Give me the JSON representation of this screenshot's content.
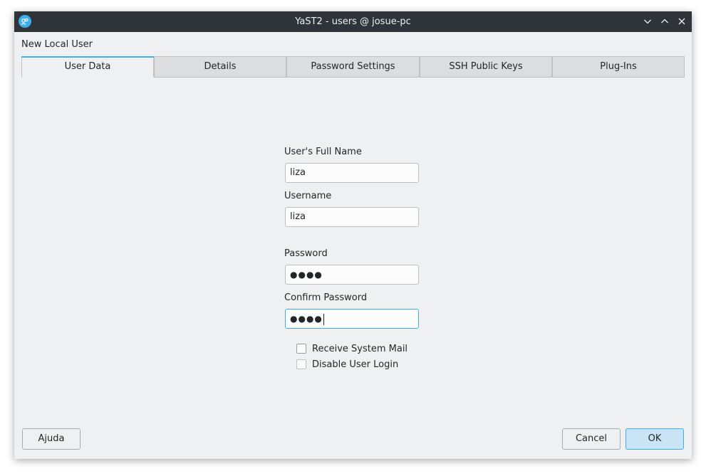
{
  "window": {
    "title": "YaST2 - users @ josue-pc",
    "controls": [
      "minimize-icon",
      "maximize-icon",
      "close-icon"
    ]
  },
  "dialog": {
    "caption": "New Local User"
  },
  "tabs": [
    {
      "label": "User Data",
      "active": true
    },
    {
      "label": "Details",
      "active": false
    },
    {
      "label": "Password Settings",
      "active": false
    },
    {
      "label": "SSH Public Keys",
      "active": false
    },
    {
      "label": "Plug-Ins",
      "active": false
    }
  ],
  "form": {
    "full_name": {
      "label": "User's Full Name",
      "value": "liza"
    },
    "username": {
      "label": "Username",
      "value": "liza"
    },
    "password": {
      "label": "Password",
      "value": "●●●●"
    },
    "confirm_password": {
      "label": "Confirm Password",
      "value": "●●●●"
    },
    "receive_mail": {
      "label": "Receive System Mail",
      "checked": false
    },
    "disable_login": {
      "label": "Disable User Login",
      "checked": false
    }
  },
  "buttons": {
    "help": "Ajuda",
    "cancel": "Cancel",
    "ok": "OK"
  },
  "colors": {
    "accent": "#3daee9",
    "titlebar": "#2f343b",
    "window_bg": "#eff0f1"
  }
}
